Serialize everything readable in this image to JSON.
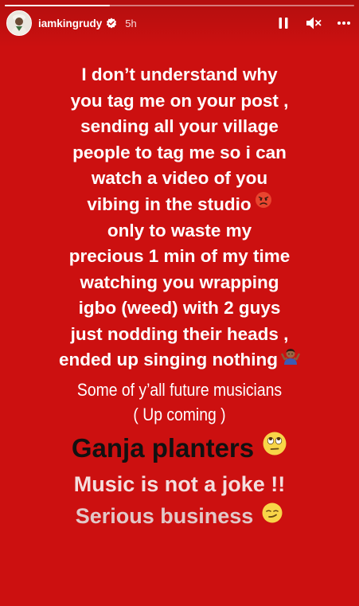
{
  "story": {
    "progress": 0.3,
    "background_color": "#cc1010"
  },
  "header": {
    "username": "iamkingrudy",
    "timestamp": "5h",
    "verified": true,
    "controls": [
      "pause-icon",
      "mute-icon",
      "more-icon"
    ]
  },
  "caption": {
    "bold_lines": [
      "I don’t understand why",
      "you tag me on your post ,",
      "sending all your village",
      "people to tag me so i can",
      "watch a video of you",
      "vibing in the studio",
      "only to waste my",
      "precious 1 min of my time",
      "watching you wrapping",
      "igbo (weed) with 2 guys",
      "just nodding their heads ,",
      "ended up singing nothing"
    ],
    "thin_lines": [
      "Some of y’all future musicians",
      "( Up coming )"
    ],
    "ganja": "Ganja planters",
    "music": "Music is not a joke !!",
    "serious": "Serious business"
  },
  "emojis": {
    "angry": "angry-face-emoji",
    "shrug": "man-shrugging-emoji",
    "eye_roll": "eye-roll-emoji",
    "smirk": "smirk-emoji"
  }
}
